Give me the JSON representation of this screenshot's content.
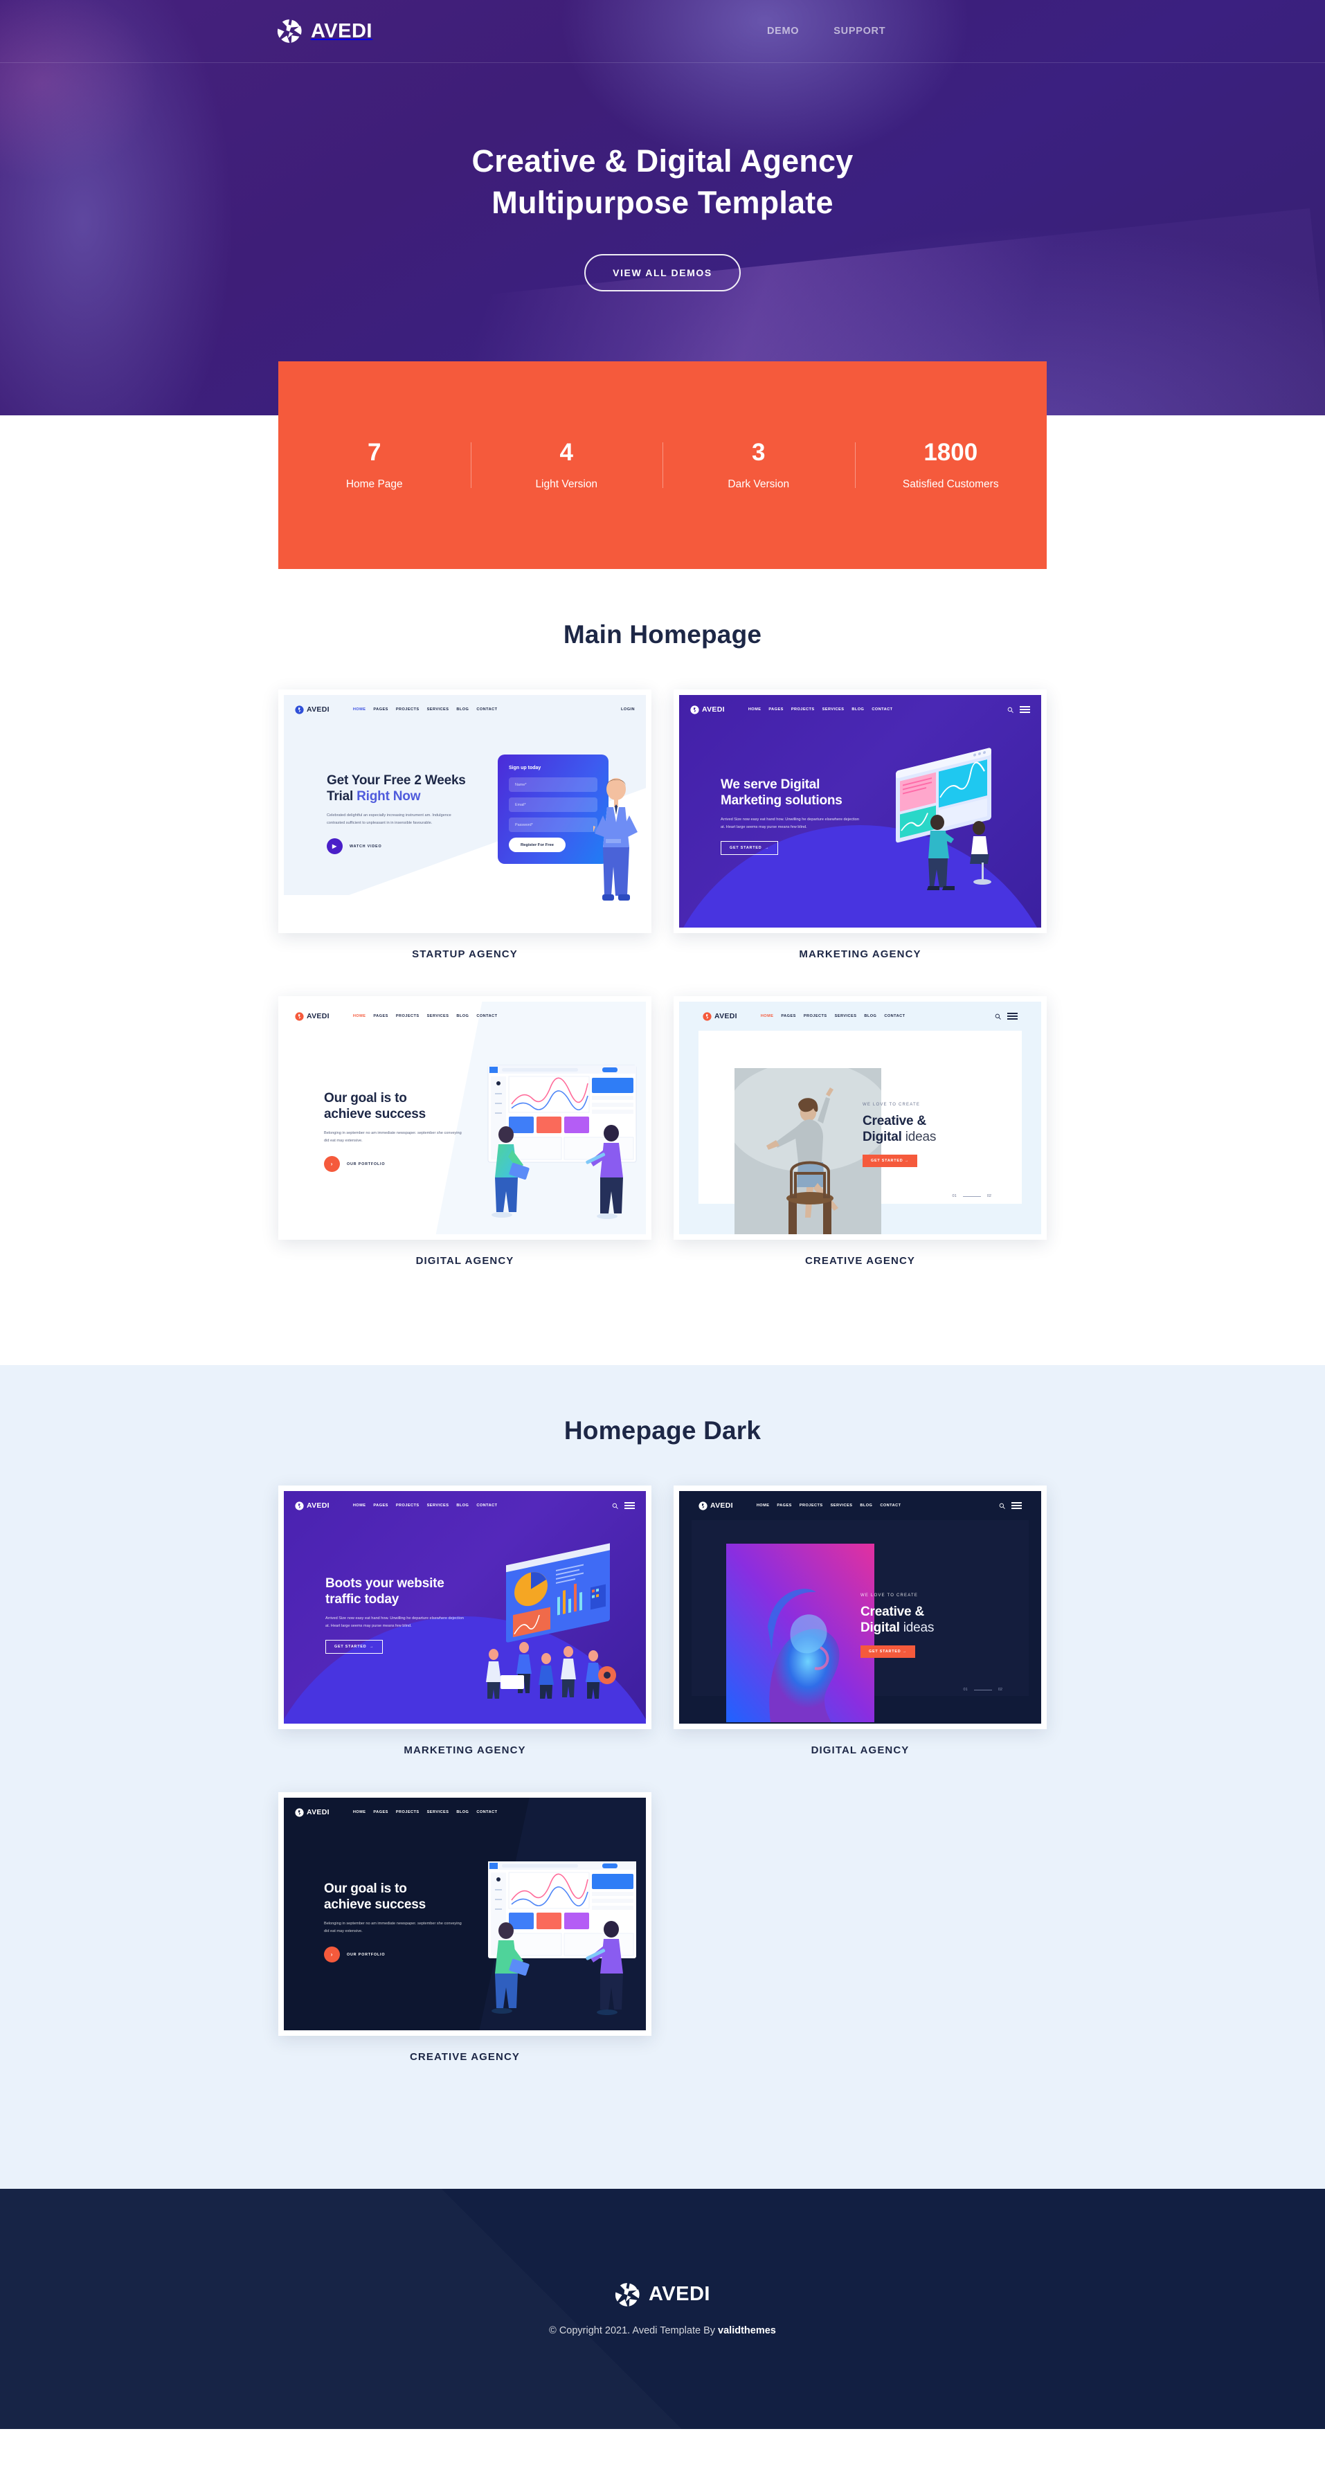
{
  "brand": {
    "name": "AVEDI",
    "logo_icon": "aperture-logo-icon"
  },
  "header": {
    "nav": [
      {
        "label": "DEMO"
      },
      {
        "label": "SUPPORT"
      }
    ]
  },
  "hero": {
    "title_line1": "Creative & Digital Agency",
    "title_line2": "Multipurpose Template",
    "cta_label": "VIEW ALL DEMOS"
  },
  "stats": {
    "bg_color": "#f55a3c",
    "items": [
      {
        "number": "7",
        "label": "Home Page"
      },
      {
        "number": "4",
        "label": "Light Version"
      },
      {
        "number": "3",
        "label": "Dark Version"
      },
      {
        "number": "1800",
        "label": "Satisfied Customers"
      }
    ]
  },
  "sections": [
    {
      "title": "Main Homepage",
      "demos": [
        {
          "caption": "STARTUP AGENCY"
        },
        {
          "caption": "MARKETING AGENCY"
        },
        {
          "caption": "DIGITAL AGENCY"
        },
        {
          "caption": "CREATIVE AGENCY"
        }
      ]
    },
    {
      "title": "Homepage Dark",
      "demos": [
        {
          "caption": "MARKETING AGENCY"
        },
        {
          "caption": "DIGITAL AGENCY"
        },
        {
          "caption": "CREATIVE AGENCY"
        }
      ]
    }
  ],
  "thumbs": {
    "startup": {
      "menu": [
        "HOME",
        "PAGES",
        "PROJECTS",
        "SERVICES",
        "BLOG",
        "CONTACT"
      ],
      "login": "LOGIN",
      "heading_a": "Get Your Free 2 Weeks",
      "heading_b": "Trial ",
      "heading_accent": "Right Now",
      "paragraph": "Celebrated delightful an especially increasing instrument am. Indulgence contrasted sufficient to unpleasant in in insensible favourable.",
      "video_label": "WATCH VIDEO",
      "form_title": "Sign up today",
      "field_name": "Name*",
      "field_email": "Email*",
      "field_password": "Password*",
      "form_button": "Register For Free"
    },
    "marketing": {
      "menu": [
        "HOME",
        "PAGES",
        "PROJECTS",
        "SERVICES",
        "BLOG",
        "CONTACT"
      ],
      "heading_a": "We serve Digital",
      "heading_b": "Marketing solutions",
      "paragraph": "Arrived Size now easy eat hand how. Unwilling he departure elsewhere dejection at. Heart large seems may purse means few blind.",
      "button": "GET STARTED"
    },
    "digital": {
      "menu": [
        "HOME",
        "PAGES",
        "PROJECTS",
        "SERVICES",
        "BLOG",
        "CONTACT"
      ],
      "heading_a": "Our goal is to",
      "heading_b": "achieve success",
      "paragraph": "Belonging in september no am immediate newspaper. september she conveying did eat may extensive.",
      "button": "OUR PORTFOLIO"
    },
    "creative": {
      "menu": [
        "HOME",
        "PAGES",
        "PROJECTS",
        "SERVICES",
        "BLOG",
        "CONTACT"
      ],
      "eyebrow": "WE LOVE TO CREATE",
      "heading_a": "Creative &",
      "heading_b": "Digital ",
      "heading_light": "ideas",
      "button": "GET STARTED",
      "pager_from": "01",
      "pager_to": "02"
    },
    "dark_marketing": {
      "menu": [
        "HOME",
        "PAGES",
        "PROJECTS",
        "SERVICES",
        "BLOG",
        "CONTACT"
      ],
      "heading_a": "Boots your website",
      "heading_b": "traffic today",
      "paragraph": "Arrived Size now easy eat hand how. Unwilling he departure elsewhere dejection at. Heart large seems may purse means few blind.",
      "button": "GET STARTED"
    }
  },
  "footer": {
    "copyright_prefix": "© Copyright 2021. Avedi Template By ",
    "copyright_brand": "validthemes"
  }
}
